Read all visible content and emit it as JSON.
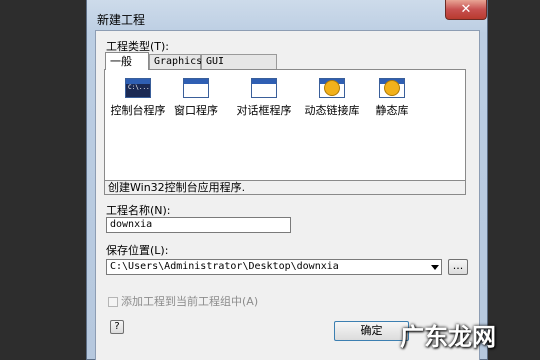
{
  "window": {
    "title": "新建工程",
    "close_glyph": "✕"
  },
  "project_type": {
    "label": "工程类型(T):",
    "tabs": [
      "一般",
      "Graphics",
      "GUI toolkits"
    ],
    "items": [
      {
        "label": "控制台程序",
        "icon": "console-app-icon",
        "icon_text": "C:\\..."
      },
      {
        "label": "窗口程序",
        "icon": "window-app-icon"
      },
      {
        "label": "对话框程序",
        "icon": "dialog-app-icon"
      },
      {
        "label": "动态链接库",
        "icon": "dll-icon"
      },
      {
        "label": "静态库",
        "icon": "static-lib-icon"
      }
    ],
    "description": "创建Win32控制台应用程序."
  },
  "project_name": {
    "label": "工程名称(N):",
    "value": "downxia"
  },
  "save_location": {
    "label": "保存位置(L):",
    "value": "C:\\Users\\Administrator\\Desktop\\downxia",
    "browse_label": "..."
  },
  "add_to_group": {
    "label": "添加工程到当前工程组中(A)",
    "checked": false,
    "enabled": false
  },
  "buttons": {
    "help_label": "?",
    "ok_label": "确定"
  },
  "watermark": "广东龙网"
}
